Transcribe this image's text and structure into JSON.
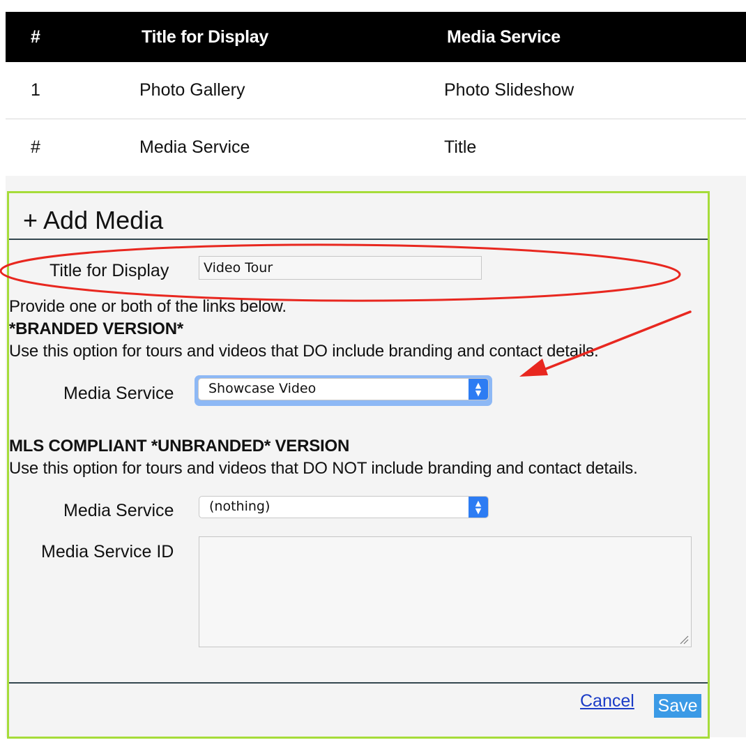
{
  "table": {
    "headers": [
      "#",
      "Title for Display",
      "Media Service"
    ],
    "rows": [
      [
        "1",
        "Photo Gallery",
        "Photo Slideshow"
      ],
      [
        "#",
        "Media Service",
        "Title"
      ]
    ]
  },
  "panel": {
    "title": "+ Add Media",
    "title_label": "Title for Display",
    "title_value": "Video Tour",
    "intro": "Provide one or both of the links below.",
    "branded_heading": "*BRANDED VERSION*",
    "branded_desc": "Use this option for tours and videos that DO include branding and contact details.",
    "branded_service_label": "Media Service",
    "branded_service_value": "Showcase Video",
    "unbranded_heading": "MLS COMPLIANT *UNBRANDED* VERSION",
    "unbranded_desc": "Use this option for tours and videos that DO NOT include branding and contact details.",
    "unbranded_service_label": "Media Service",
    "unbranded_service_value": "(nothing)",
    "service_id_label": "Media Service ID",
    "service_id_value": "",
    "cancel_label": "Cancel",
    "save_label": "Save"
  },
  "colors": {
    "header_bg": "#000000",
    "panel_border": "#a6dc3a",
    "annotation": "#e8271f",
    "select_accent": "#2d7cf3",
    "save_bg": "#3b9ae6",
    "link": "#1b3cc7"
  },
  "icons": {
    "select_arrows": "chevron-up-down-icon",
    "resize": "resize-grip-icon"
  }
}
